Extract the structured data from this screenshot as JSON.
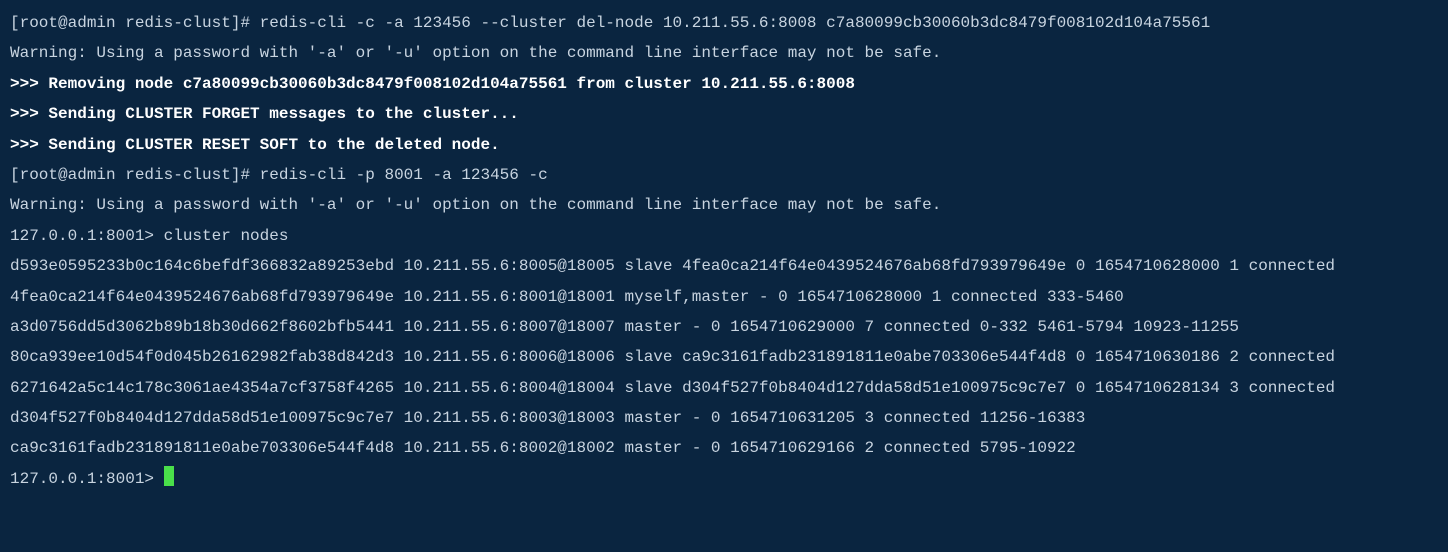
{
  "lines": {
    "l1_prompt": "[root@admin redis-clust]# ",
    "l1_cmd": "redis-cli -c -a 123456 --cluster del-node 10.211.55.6:8008 c7a80099cb30060b3dc8479f008102d104a75561",
    "l2": "Warning: Using a password with '-a' or '-u' option on the command line interface may not be safe.",
    "l3": ">>> Removing node c7a80099cb30060b3dc8479f008102d104a75561 from cluster 10.211.55.6:8008",
    "l4": ">>> Sending CLUSTER FORGET messages to the cluster...",
    "l5": ">>> Sending CLUSTER RESET SOFT to the deleted node.",
    "l6_prompt": "[root@admin redis-clust]# ",
    "l6_cmd": "redis-cli -p 8001 -a 123456 -c",
    "l7": "Warning: Using a password with '-a' or '-u' option on the command line interface may not be safe.",
    "l8_prompt": "127.0.0.1:8001> ",
    "l8_cmd": "cluster nodes",
    "l9": "d593e0595233b0c164c6befdf366832a89253ebd 10.211.55.6:8005@18005 slave 4fea0ca214f64e0439524676ab68fd793979649e 0 1654710628000 1 connected",
    "l10": "4fea0ca214f64e0439524676ab68fd793979649e 10.211.55.6:8001@18001 myself,master - 0 1654710628000 1 connected 333-5460",
    "l11": "a3d0756dd5d3062b89b18b30d662f8602bfb5441 10.211.55.6:8007@18007 master - 0 1654710629000 7 connected 0-332 5461-5794 10923-11255",
    "l12": "80ca939ee10d54f0d045b26162982fab38d842d3 10.211.55.6:8006@18006 slave ca9c3161fadb231891811e0abe703306e544f4d8 0 1654710630186 2 connected",
    "l13": "6271642a5c14c178c3061ae4354a7cf3758f4265 10.211.55.6:8004@18004 slave d304f527f0b8404d127dda58d51e100975c9c7e7 0 1654710628134 3 connected",
    "l14": "d304f527f0b8404d127dda58d51e100975c9c7e7 10.211.55.6:8003@18003 master - 0 1654710631205 3 connected 11256-16383",
    "l15": "ca9c3161fadb231891811e0abe703306e544f4d8 10.211.55.6:8002@18002 master - 0 1654710629166 2 connected 5795-10922",
    "l16_prompt": "127.0.0.1:8001> "
  }
}
